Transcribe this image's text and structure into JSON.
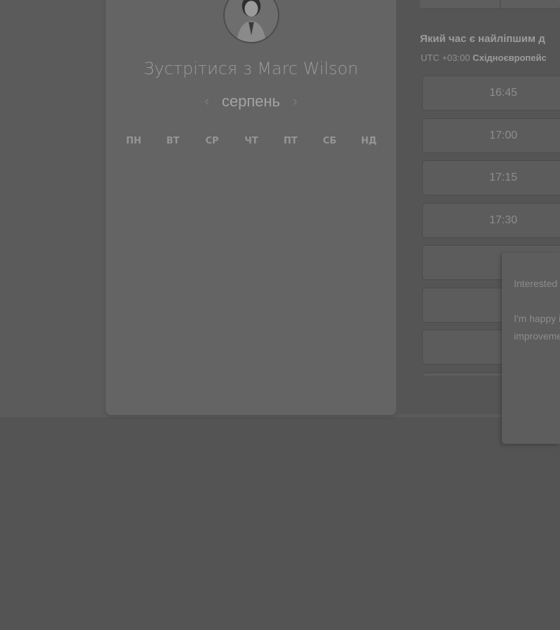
{
  "booking": {
    "meet_title": "Зустрітися з Marc Wilson",
    "month": "серпень",
    "prev_icon": "chevron-left-icon",
    "next_icon": "chevron-right-icon",
    "weekdays": [
      "ПН",
      "ВТ",
      "СР",
      "ЧТ",
      "ПТ",
      "СБ",
      "НД"
    ]
  },
  "times": {
    "question": "Який час є найліпшим д",
    "tz_offset": "UTC +03:00",
    "tz_name": "Східноєвропейс",
    "slots": [
      "16:45",
      "17:00",
      "17:15",
      "17:30",
      "",
      "",
      "",
      ""
    ]
  },
  "popup": {
    "paragraph1": "Interested Managem department",
    "paragraph2": "I'm happy insight into use our pla improveme productivit"
  },
  "colors": {
    "overlay_dim": "#545454",
    "card": "#646464"
  }
}
